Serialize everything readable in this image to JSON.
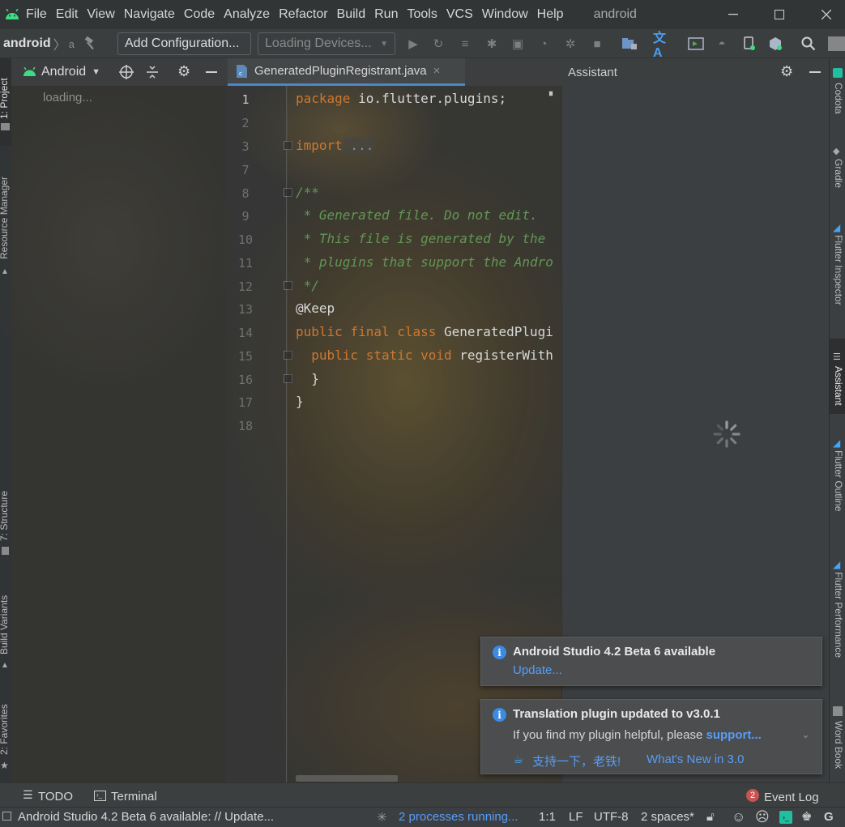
{
  "menubar": {
    "items": [
      "File",
      "Edit",
      "View",
      "Navigate",
      "Code",
      "Analyze",
      "Refactor",
      "Build",
      "Run",
      "Tools",
      "VCS",
      "Window",
      "Help"
    ],
    "window_title": "android"
  },
  "toolbar": {
    "breadcrumb": "android",
    "breadcrumb_sep": "〉",
    "breadcrumb_trunc": "a",
    "add_config": "Add Configuration...",
    "devices": "Loading Devices..."
  },
  "left_strip": {
    "project": "1: Project",
    "resource_manager": "Resource Manager",
    "structure": "7: Structure",
    "build_variants": "Build Variants",
    "favorites": "2: Favorites"
  },
  "project": {
    "view_selector": "Android",
    "loading": "loading..."
  },
  "editor": {
    "tab_label": "GeneratedPluginRegistrant.java",
    "line_numbers": [
      "1",
      "2",
      "3",
      "7",
      "8",
      "9",
      "10",
      "11",
      "12",
      "13",
      "14",
      "15",
      "16",
      "17",
      "18"
    ],
    "code": {
      "l1_kw": "package",
      "l1_rest": " io.flutter.plugins;",
      "l3_kw": "import",
      "l3_rest": " ...",
      "l8": "/**",
      "l9": " * Generated file. Do not edit.",
      "l10": " * This file is generated by the",
      "l11": " * plugins that support the Andro",
      "l12": " */",
      "l13": "@Keep",
      "l14_kw": "public final class",
      "l14_rest": " GeneratedPlugi",
      "l15_kw": "  public static void",
      "l15_rest": " registerWith",
      "l16": "  }",
      "l17": "}"
    }
  },
  "assistant": {
    "title": "Assistant"
  },
  "right_strip": {
    "codota": "Codota",
    "gradle": "Gradle",
    "flutter_inspector": "Flutter Inspector",
    "assistant": "Assistant",
    "flutter_outline": "Flutter Outline",
    "flutter_performance": "Flutter Performance",
    "word_book": "Word Book"
  },
  "notifications": {
    "n1": {
      "title": "Android Studio 4.2 Beta 6 available",
      "link": "Update..."
    },
    "n2": {
      "title": "Translation plugin updated to v3.0.1",
      "body": "If you find my plugin helpful, please ",
      "body_link": "support...",
      "action1": "支持一下，老铁!",
      "action2": "What's New in 3.0"
    }
  },
  "bottom_tools": {
    "todo": "TODO",
    "terminal": "Terminal",
    "event_log": "Event Log",
    "event_count": "2"
  },
  "statusbar": {
    "message": "Android Studio 4.2 Beta 6 available: // Update...",
    "processes": "2 processes running...",
    "position": "1:1",
    "line_sep": "LF",
    "encoding": "UTF-8",
    "indent": "2 spaces*"
  },
  "colors": {
    "keyword": "#cc7832",
    "comment": "#629755",
    "annotation": "#bbb529",
    "link": "#589df6",
    "android_green": "#3ddc84",
    "flutter_blue": "#42a5f5"
  }
}
